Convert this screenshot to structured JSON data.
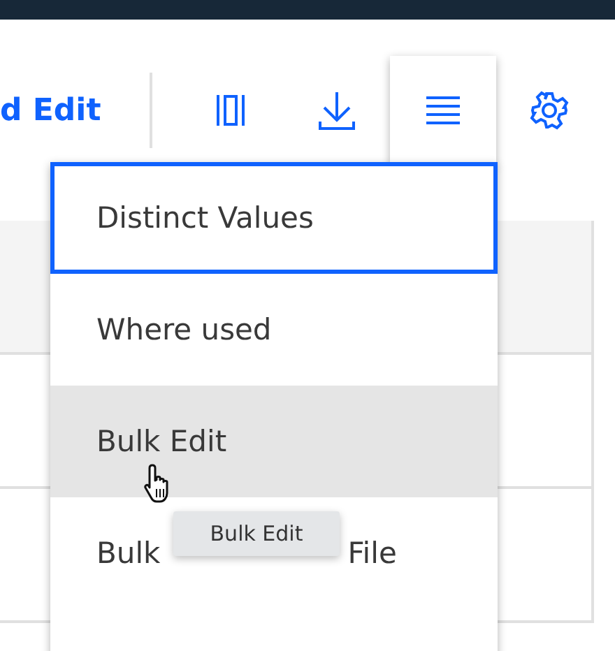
{
  "toolbar": {
    "edit_link": "d Edit",
    "icon_buttons": [
      {
        "kind": "columns",
        "selected": false
      },
      {
        "kind": "download",
        "selected": false
      },
      {
        "kind": "menu",
        "selected": true
      },
      {
        "kind": "settings",
        "selected": false
      }
    ]
  },
  "menu": {
    "items": [
      {
        "label": "Distinct Values",
        "focused": true,
        "hovered": false
      },
      {
        "label": "Where used",
        "focused": false,
        "hovered": false
      },
      {
        "label": "Bulk Edit",
        "focused": false,
        "hovered": true
      },
      {
        "label_parts": [
          "Bulk",
          "File"
        ],
        "focused": false,
        "hovered": false
      }
    ]
  },
  "tooltip": {
    "text": "Bulk Edit"
  }
}
